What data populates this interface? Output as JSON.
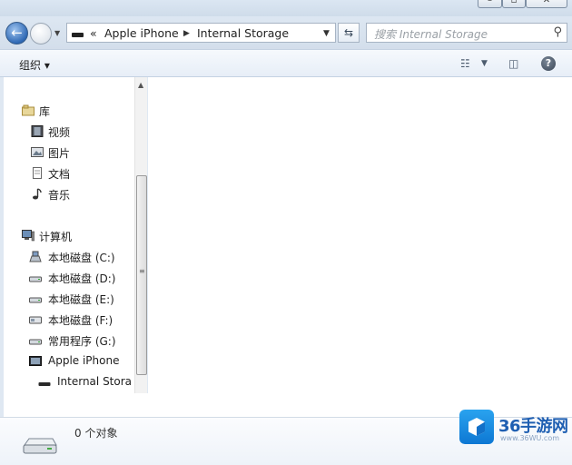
{
  "address_bar": {
    "overflow": "«",
    "segments": [
      "Apple iPhone",
      "Internal Storage"
    ]
  },
  "search": {
    "placeholder": "搜索 Internal Storage"
  },
  "toolbar": {
    "organize_label": "组织 ▾"
  },
  "nav_pane": {
    "libraries": {
      "label": "库",
      "items": [
        "视频",
        "图片",
        "文档",
        "音乐"
      ]
    },
    "computer": {
      "label": "计算机",
      "items": [
        "本地磁盘 (C:)",
        "本地磁盘 (D:)",
        "本地磁盘 (E:)",
        "本地磁盘 (F:)",
        "常用程序 (G:)",
        "Apple iPhone",
        "Internal Stora"
      ]
    }
  },
  "details": {
    "item_count": "0 个对象"
  },
  "watermark": {
    "brand": "36手游网",
    "url": "www.36WU.com"
  },
  "icons": [
    "back-icon",
    "forward-icon",
    "refresh-icon",
    "search-icon",
    "view-options-icon",
    "preview-pane-icon",
    "help-icon",
    "library-icon",
    "video-icon",
    "picture-icon",
    "document-icon",
    "music-icon",
    "computer-icon",
    "drive-icon",
    "phone-icon"
  ]
}
